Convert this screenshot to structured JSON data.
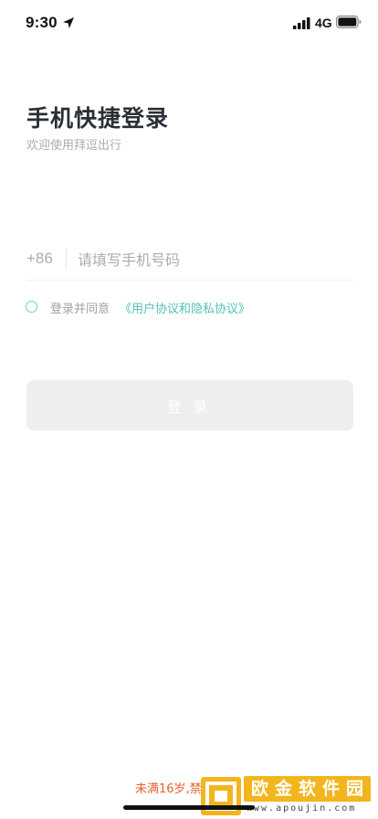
{
  "status_bar": {
    "time": "9:30",
    "network": "4G",
    "icons": [
      "location-arrow-icon",
      "signal-bars-icon",
      "battery-icon"
    ]
  },
  "header": {
    "title": "手机快捷登录",
    "subtitle": "欢迎使用拜逗出行"
  },
  "phone_field": {
    "country_code": "+86",
    "placeholder": "请填写手机号码",
    "value": ""
  },
  "agreement": {
    "checked": false,
    "prefix": "登录并同意",
    "link": "《用户协议和隐私协议》"
  },
  "login_button": {
    "label": "登录",
    "enabled": false
  },
  "footer": {
    "age_notice": "未满16岁,禁止..."
  },
  "watermark": {
    "name": "欧金软件园",
    "url": "www.apoujin.com"
  },
  "colors": {
    "accent": "#4fc3b2",
    "title": "#2b2f36",
    "placeholder": "#a9adb3",
    "button_disabled": "#eeeeee",
    "warning": "#e8612c",
    "watermark": "#f2b51d"
  }
}
